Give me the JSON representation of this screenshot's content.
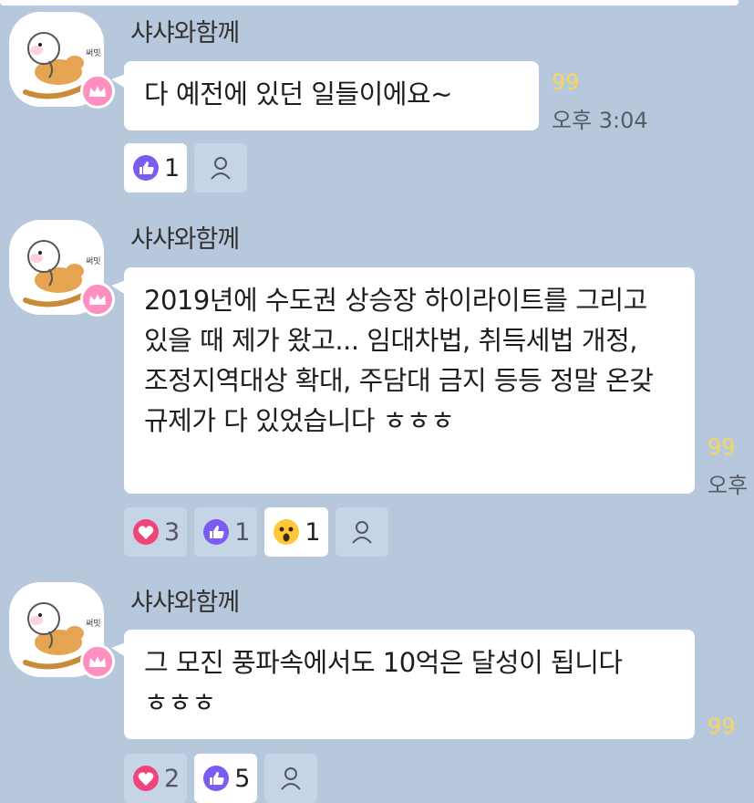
{
  "messages": [
    {
      "sender": "샤샤와함께",
      "text": "다 예전에 있던 일들이에요~",
      "unread": "99",
      "time": "오후 3:04",
      "reactions": [
        {
          "icon": "thumbs-up-icon",
          "count": "1",
          "active": true
        }
      ]
    },
    {
      "sender": "샤샤와함께",
      "text": "2019년에 수도권 상승장 하이라이트를 그리고 있을 때 제가 왔고... 임대차법, 취득세법 개정, 조정지역대상 확대, 주담대 금지 등등 정말 온갖 규제가 다 있었습니다 ㅎㅎㅎ",
      "unread": "99",
      "time": "오후",
      "reactions": [
        {
          "icon": "heart-icon",
          "count": "3",
          "active": false
        },
        {
          "icon": "thumbs-up-icon",
          "count": "1",
          "active": false
        },
        {
          "icon": "surprised-face-icon",
          "count": "1",
          "active": true
        }
      ]
    },
    {
      "sender": "샤샤와함께",
      "text": "그 모진 풍파속에서도 10억은 달성이 됩니다 ㅎㅎㅎ",
      "unread": "99",
      "time": "",
      "reactions": [
        {
          "icon": "heart-icon",
          "count": "2",
          "active": false
        },
        {
          "icon": "thumbs-up-icon",
          "count": "5",
          "active": true
        }
      ]
    }
  ],
  "avatar_badge": "crown-icon",
  "avatar_label": "써밋",
  "colors": {
    "background": "#b7c8dc",
    "unread": "#f6d65a",
    "heart": "#f0457a",
    "thumbs": "#7b5cf0",
    "badge": "#ff8fc0"
  }
}
